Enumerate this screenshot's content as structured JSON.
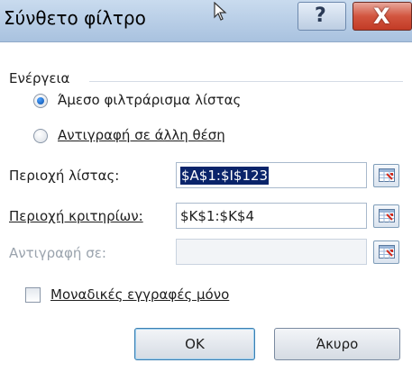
{
  "window": {
    "title": "Σύνθετο φίλτρο",
    "help_label": "?",
    "close_label": "X"
  },
  "action": {
    "group_label": "Ενέργεια",
    "options": [
      {
        "label": "Άμεσο φιλτράρισμα λίστας",
        "selected": true
      },
      {
        "label": "Αντιγραφή σε άλλη θέση",
        "selected": false
      }
    ]
  },
  "fields": {
    "list_range": {
      "label": "Περιοχή λίστας:",
      "value": "$A$1:$I$123"
    },
    "criteria_range": {
      "label": "Περιοχή κριτηρίων:",
      "value": "$K$1:$K$4"
    },
    "copy_to": {
      "label": "Αντιγραφή σε:",
      "value": "",
      "disabled": true
    }
  },
  "unique": {
    "label": "Μοναδικές εγγραφές μόνο",
    "checked": false
  },
  "buttons": {
    "ok": "OK",
    "cancel": "Άκυρο"
  }
}
